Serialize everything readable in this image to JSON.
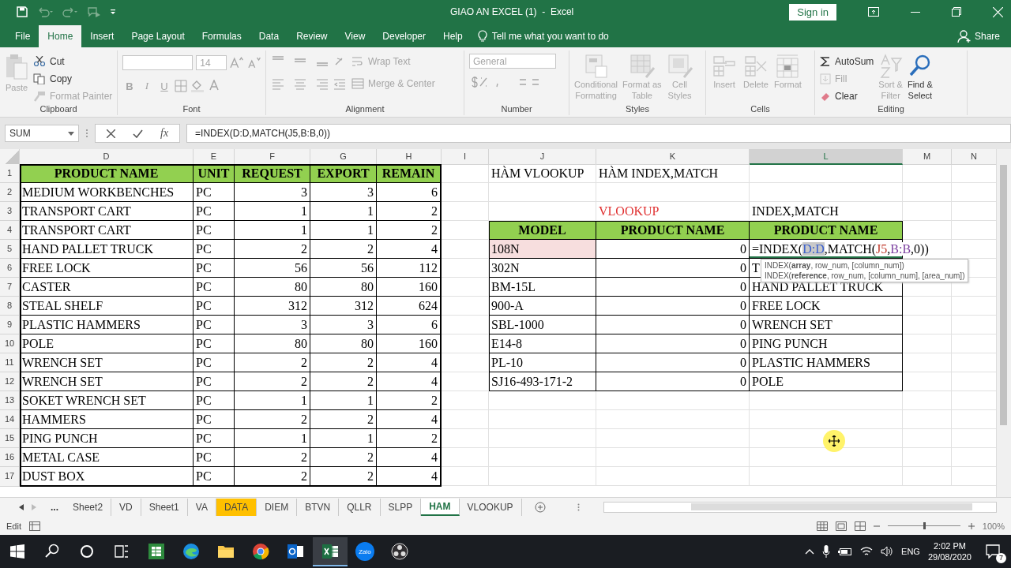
{
  "title_bar": {
    "title": "GIAO AN EXCEL (1)  -  Excel",
    "sign_in": "Sign in"
  },
  "menu": [
    {
      "label": "File",
      "selected": false
    },
    {
      "label": "Home",
      "selected": true
    },
    {
      "label": "Insert",
      "selected": false
    },
    {
      "label": "Page Layout",
      "selected": false
    },
    {
      "label": "Formulas",
      "selected": false
    },
    {
      "label": "Data",
      "selected": false
    },
    {
      "label": "Review",
      "selected": false
    },
    {
      "label": "View",
      "selected": false
    },
    {
      "label": "Developer",
      "selected": false
    },
    {
      "label": "Help",
      "selected": false
    }
  ],
  "tell_me": "Tell me what you want to do",
  "share": "Share",
  "ribbon": {
    "clipboard": {
      "label": "Clipboard",
      "paste": {
        "label": "Paste",
        "disabled": true
      },
      "cut": {
        "label": "Cut",
        "disabled": false
      },
      "copy": {
        "label": "Copy",
        "disabled": false
      },
      "format_painter": {
        "label": "Format Painter",
        "disabled": true
      }
    },
    "font": {
      "label": "Font",
      "size": "14",
      "format_buttons": [
        "B",
        "I",
        "U"
      ],
      "disabled": true
    },
    "alignment": {
      "label": "Alignment",
      "wrap": "Wrap Text",
      "merge": "Merge & Center",
      "disabled": true
    },
    "number": {
      "label": "Number",
      "format": "General",
      "disabled": true
    },
    "styles": {
      "label": "Styles",
      "items": [
        {
          "lines": [
            "Conditional",
            "Formatting"
          ],
          "kind": "conditional",
          "disabled": true
        },
        {
          "lines": [
            "Format as",
            "Table"
          ],
          "kind": "table",
          "disabled": true
        },
        {
          "lines": [
            "Cell",
            "Styles"
          ],
          "kind": "styles",
          "disabled": true
        }
      ]
    },
    "cells": {
      "label": "Cells",
      "items": [
        {
          "label": "Insert",
          "kind": "insert",
          "disabled": true
        },
        {
          "label": "Delete",
          "kind": "delete",
          "disabled": true
        },
        {
          "label": "Format",
          "kind": "format",
          "disabled": true
        }
      ]
    },
    "editing": {
      "label": "Editing",
      "autosum": {
        "label": "AutoSum",
        "disabled": false
      },
      "fill": {
        "label": "Fill",
        "disabled": true
      },
      "clear": {
        "label": "Clear",
        "disabled": false
      },
      "sort": {
        "lines": [
          "Sort &",
          "Filter"
        ],
        "disabled": true
      },
      "find": {
        "lines": [
          "Find &",
          "Select"
        ],
        "disabled": false
      }
    }
  },
  "formula_bar": {
    "name_box": "SUM",
    "fx": "fx",
    "formula": "=INDEX(D:D,MATCH(J5,B:B,0))"
  },
  "columns": [
    {
      "label": "D",
      "selected": false
    },
    {
      "label": "E",
      "selected": false
    },
    {
      "label": "F",
      "selected": false
    },
    {
      "label": "G",
      "selected": false
    },
    {
      "label": "H",
      "selected": false
    },
    {
      "label": "I",
      "selected": false
    },
    {
      "label": "J",
      "selected": false
    },
    {
      "label": "K",
      "selected": false
    },
    {
      "label": "L",
      "selected": true
    },
    {
      "label": "M",
      "selected": false
    },
    {
      "label": "N",
      "selected": false
    }
  ],
  "rows": [
    {
      "number": "1",
      "cells": [
        {
          "text": "PRODUCT NAME",
          "kind": "header"
        },
        {
          "text": "UNIT",
          "kind": "header"
        },
        {
          "text": "REQUEST",
          "kind": "header"
        },
        {
          "text": "EXPORT",
          "kind": "header"
        },
        {
          "text": "REMAIN",
          "kind": "header"
        }
      ],
      "right": [
        {
          "text": "HÀM VLOOKUP",
          "kind": "plain"
        },
        {
          "text": "HÀM INDEX,MATCH",
          "kind": "plain"
        },
        {
          "kind": "blank"
        }
      ]
    },
    {
      "number": "2",
      "cells": [
        {
          "text": "MEDIUM WORKBENCHES",
          "kind": "text"
        },
        {
          "text": "PC",
          "kind": "text"
        },
        {
          "text": "3",
          "kind": "number"
        },
        {
          "text": "3",
          "kind": "number"
        },
        {
          "text": "6",
          "kind": "number"
        }
      ]
    },
    {
      "number": "3",
      "cells": [
        {
          "text": "TRANSPORT CART",
          "kind": "text"
        },
        {
          "text": "PC",
          "kind": "text"
        },
        {
          "text": "1",
          "kind": "number"
        },
        {
          "text": "1",
          "kind": "number"
        },
        {
          "text": "2",
          "kind": "number"
        }
      ],
      "right": [
        {
          "kind": "blank"
        },
        {
          "text": "VLOOKUP",
          "kind": "note"
        },
        {
          "text": "INDEX,MATCH",
          "kind": "plain"
        }
      ]
    },
    {
      "number": "4",
      "cells": [
        {
          "text": "TRANSPORT CART",
          "kind": "text"
        },
        {
          "text": "PC",
          "kind": "text"
        },
        {
          "text": "1",
          "kind": "number"
        },
        {
          "text": "1",
          "kind": "number"
        },
        {
          "text": "2",
          "kind": "number"
        }
      ],
      "right": [
        {
          "text": "MODEL",
          "kind": "header"
        },
        {
          "text": "PRODUCT NAME",
          "kind": "header"
        },
        {
          "text": "PRODUCT NAME",
          "kind": "header"
        }
      ]
    },
    {
      "number": "5",
      "cells": [
        {
          "text": "HAND PALLET TRUCK",
          "kind": "text"
        },
        {
          "text": "PC",
          "kind": "text"
        },
        {
          "text": "2",
          "kind": "number"
        },
        {
          "text": "2",
          "kind": "number"
        },
        {
          "text": "4",
          "kind": "number"
        }
      ],
      "right": [
        {
          "text": "108N",
          "kind": "ref"
        },
        {
          "text": "0",
          "kind": "number"
        },
        {
          "kind": "formula",
          "parts": [
            {
              "text": "=INDEX(",
              "selected": false
            },
            {
              "text": "D:D",
              "color": "#3a5fcd",
              "selected": true
            },
            {
              "text": ",MATCH(",
              "selected": false
            },
            {
              "text": "J5",
              "color": "#c0392b",
              "selected": false
            },
            {
              "text": ",",
              "selected": false
            },
            {
              "text": "B:B",
              "color": "#7b3fa0",
              "selected": false
            },
            {
              "text": ",0))",
              "selected": false
            }
          ],
          "tooltip": [
            "INDEX(**array**, row_num, [column_num])",
            "INDEX(**reference**, row_num, [column_num], [area_num])"
          ]
        }
      ]
    },
    {
      "number": "6",
      "cells": [
        {
          "text": "FREE LOCK",
          "kind": "text"
        },
        {
          "text": "PC",
          "kind": "text"
        },
        {
          "text": "56",
          "kind": "number"
        },
        {
          "text": "56",
          "kind": "number"
        },
        {
          "text": "112",
          "kind": "number"
        }
      ],
      "right": [
        {
          "text": "302N",
          "kind": "text"
        },
        {
          "text": "0",
          "kind": "number"
        },
        {
          "text": "T",
          "kind": "text"
        }
      ]
    },
    {
      "number": "7",
      "cells": [
        {
          "text": "CASTER",
          "kind": "text"
        },
        {
          "text": "PC",
          "kind": "text"
        },
        {
          "text": "80",
          "kind": "number"
        },
        {
          "text": "80",
          "kind": "number"
        },
        {
          "text": "160",
          "kind": "number"
        }
      ],
      "right": [
        {
          "text": "BM-15L",
          "kind": "text"
        },
        {
          "text": "0",
          "kind": "number"
        },
        {
          "text": "HAND PALLET TRUCK",
          "kind": "text"
        }
      ]
    },
    {
      "number": "8",
      "cells": [
        {
          "text": "STEAL SHELF",
          "kind": "text"
        },
        {
          "text": "PC",
          "kind": "text"
        },
        {
          "text": "312",
          "kind": "number"
        },
        {
          "text": "312",
          "kind": "number"
        },
        {
          "text": "624",
          "kind": "number"
        }
      ],
      "right": [
        {
          "text": "900-A",
          "kind": "text"
        },
        {
          "text": "0",
          "kind": "number"
        },
        {
          "text": "FREE LOCK",
          "kind": "text"
        }
      ]
    },
    {
      "number": "9",
      "cells": [
        {
          "text": "PLASTIC HAMMERS",
          "kind": "text"
        },
        {
          "text": "PC",
          "kind": "text"
        },
        {
          "text": "3",
          "kind": "number"
        },
        {
          "text": "3",
          "kind": "number"
        },
        {
          "text": "6",
          "kind": "number"
        }
      ],
      "right": [
        {
          "text": "SBL-1000",
          "kind": "text"
        },
        {
          "text": "0",
          "kind": "number"
        },
        {
          "text": "WRENCH SET",
          "kind": "text"
        }
      ]
    },
    {
      "number": "10",
      "cells": [
        {
          "text": "POLE",
          "kind": "text"
        },
        {
          "text": "PC",
          "kind": "text"
        },
        {
          "text": "80",
          "kind": "number"
        },
        {
          "text": "80",
          "kind": "number"
        },
        {
          "text": "160",
          "kind": "number"
        }
      ],
      "right": [
        {
          "text": "E14-8",
          "kind": "text"
        },
        {
          "text": "0",
          "kind": "number"
        },
        {
          "text": "PING PUNCH",
          "kind": "text"
        }
      ]
    },
    {
      "number": "11",
      "cells": [
        {
          "text": "WRENCH SET",
          "kind": "text"
        },
        {
          "text": "PC",
          "kind": "text"
        },
        {
          "text": "2",
          "kind": "number"
        },
        {
          "text": "2",
          "kind": "number"
        },
        {
          "text": "4",
          "kind": "number"
        }
      ],
      "right": [
        {
          "text": "PL-10",
          "kind": "text"
        },
        {
          "text": "0",
          "kind": "number"
        },
        {
          "text": "PLASTIC HAMMERS",
          "kind": "text"
        }
      ]
    },
    {
      "number": "12",
      "cells": [
        {
          "text": "WRENCH SET",
          "kind": "text"
        },
        {
          "text": "PC",
          "kind": "text"
        },
        {
          "text": "2",
          "kind": "number"
        },
        {
          "text": "2",
          "kind": "number"
        },
        {
          "text": "4",
          "kind": "number"
        }
      ],
      "right": [
        {
          "text": "SJ16-493-171-2",
          "kind": "text"
        },
        {
          "text": "0",
          "kind": "number"
        },
        {
          "text": "POLE",
          "kind": "text"
        }
      ]
    },
    {
      "number": "13",
      "cells": [
        {
          "text": "SOKET WRENCH SET",
          "kind": "text"
        },
        {
          "text": "PC",
          "kind": "text"
        },
        {
          "text": "1",
          "kind": "number"
        },
        {
          "text": "1",
          "kind": "number"
        },
        {
          "text": "2",
          "kind": "number"
        }
      ]
    },
    {
      "number": "14",
      "cells": [
        {
          "text": "HAMMERS",
          "kind": "text"
        },
        {
          "text": "PC",
          "kind": "text"
        },
        {
          "text": "2",
          "kind": "number"
        },
        {
          "text": "2",
          "kind": "number"
        },
        {
          "text": "4",
          "kind": "number"
        }
      ]
    },
    {
      "number": "15",
      "cells": [
        {
          "text": "PING PUNCH",
          "kind": "text"
        },
        {
          "text": "PC",
          "kind": "text"
        },
        {
          "text": "1",
          "kind": "number"
        },
        {
          "text": "1",
          "kind": "number"
        },
        {
          "text": "2",
          "kind": "number"
        }
      ]
    },
    {
      "number": "16",
      "cells": [
        {
          "text": "METAL CASE",
          "kind": "text"
        },
        {
          "text": "PC",
          "kind": "text"
        },
        {
          "text": "2",
          "kind": "number"
        },
        {
          "text": "2",
          "kind": "number"
        },
        {
          "text": "4",
          "kind": "number"
        }
      ]
    },
    {
      "number": "17",
      "cells": [
        {
          "text": "DUST BOX",
          "kind": "text"
        },
        {
          "text": "PC",
          "kind": "text"
        },
        {
          "text": "2",
          "kind": "number"
        },
        {
          "text": "2",
          "kind": "number"
        },
        {
          "text": "4",
          "kind": "number"
        }
      ]
    }
  ],
  "sheet_tabs": {
    "more": "...",
    "tabs": [
      {
        "label": "Sheet2",
        "selected": false
      },
      {
        "label": "VD",
        "selected": false
      },
      {
        "label": "Sheet1",
        "selected": false
      },
      {
        "label": "VA",
        "selected": false
      },
      {
        "label": "DATA",
        "selected": false,
        "color": "#ffc000"
      },
      {
        "label": "DIEM",
        "selected": false
      },
      {
        "label": "BTVN",
        "selected": false
      },
      {
        "label": "QLLR",
        "selected": false
      },
      {
        "label": "SLPP",
        "selected": false
      },
      {
        "label": "HAM",
        "selected": true
      },
      {
        "label": "VLOOKUP",
        "selected": false
      }
    ]
  },
  "status_bar": {
    "mode": "Edit",
    "zoom": {
      "level": 0.5,
      "reading": "100%"
    }
  },
  "taskbar": {
    "apps": [
      {
        "kind": "start",
        "selected": false
      },
      {
        "kind": "search",
        "selected": false
      },
      {
        "kind": "cortana",
        "selected": false
      },
      {
        "kind": "taskview",
        "selected": false
      },
      {
        "kind": "sheets",
        "selected": false
      },
      {
        "kind": "edge",
        "selected": false
      },
      {
        "kind": "folder",
        "selected": false
      },
      {
        "kind": "chrome",
        "selected": false
      },
      {
        "kind": "outlook",
        "selected": false
      },
      {
        "kind": "excel",
        "selected": true
      },
      {
        "kind": "zalo",
        "selected": false,
        "label": "Zalo"
      },
      {
        "kind": "obs",
        "selected": false
      }
    ],
    "language": "ENG",
    "time": "2:02 PM",
    "date": "29/08/2020",
    "notifications": "7"
  }
}
